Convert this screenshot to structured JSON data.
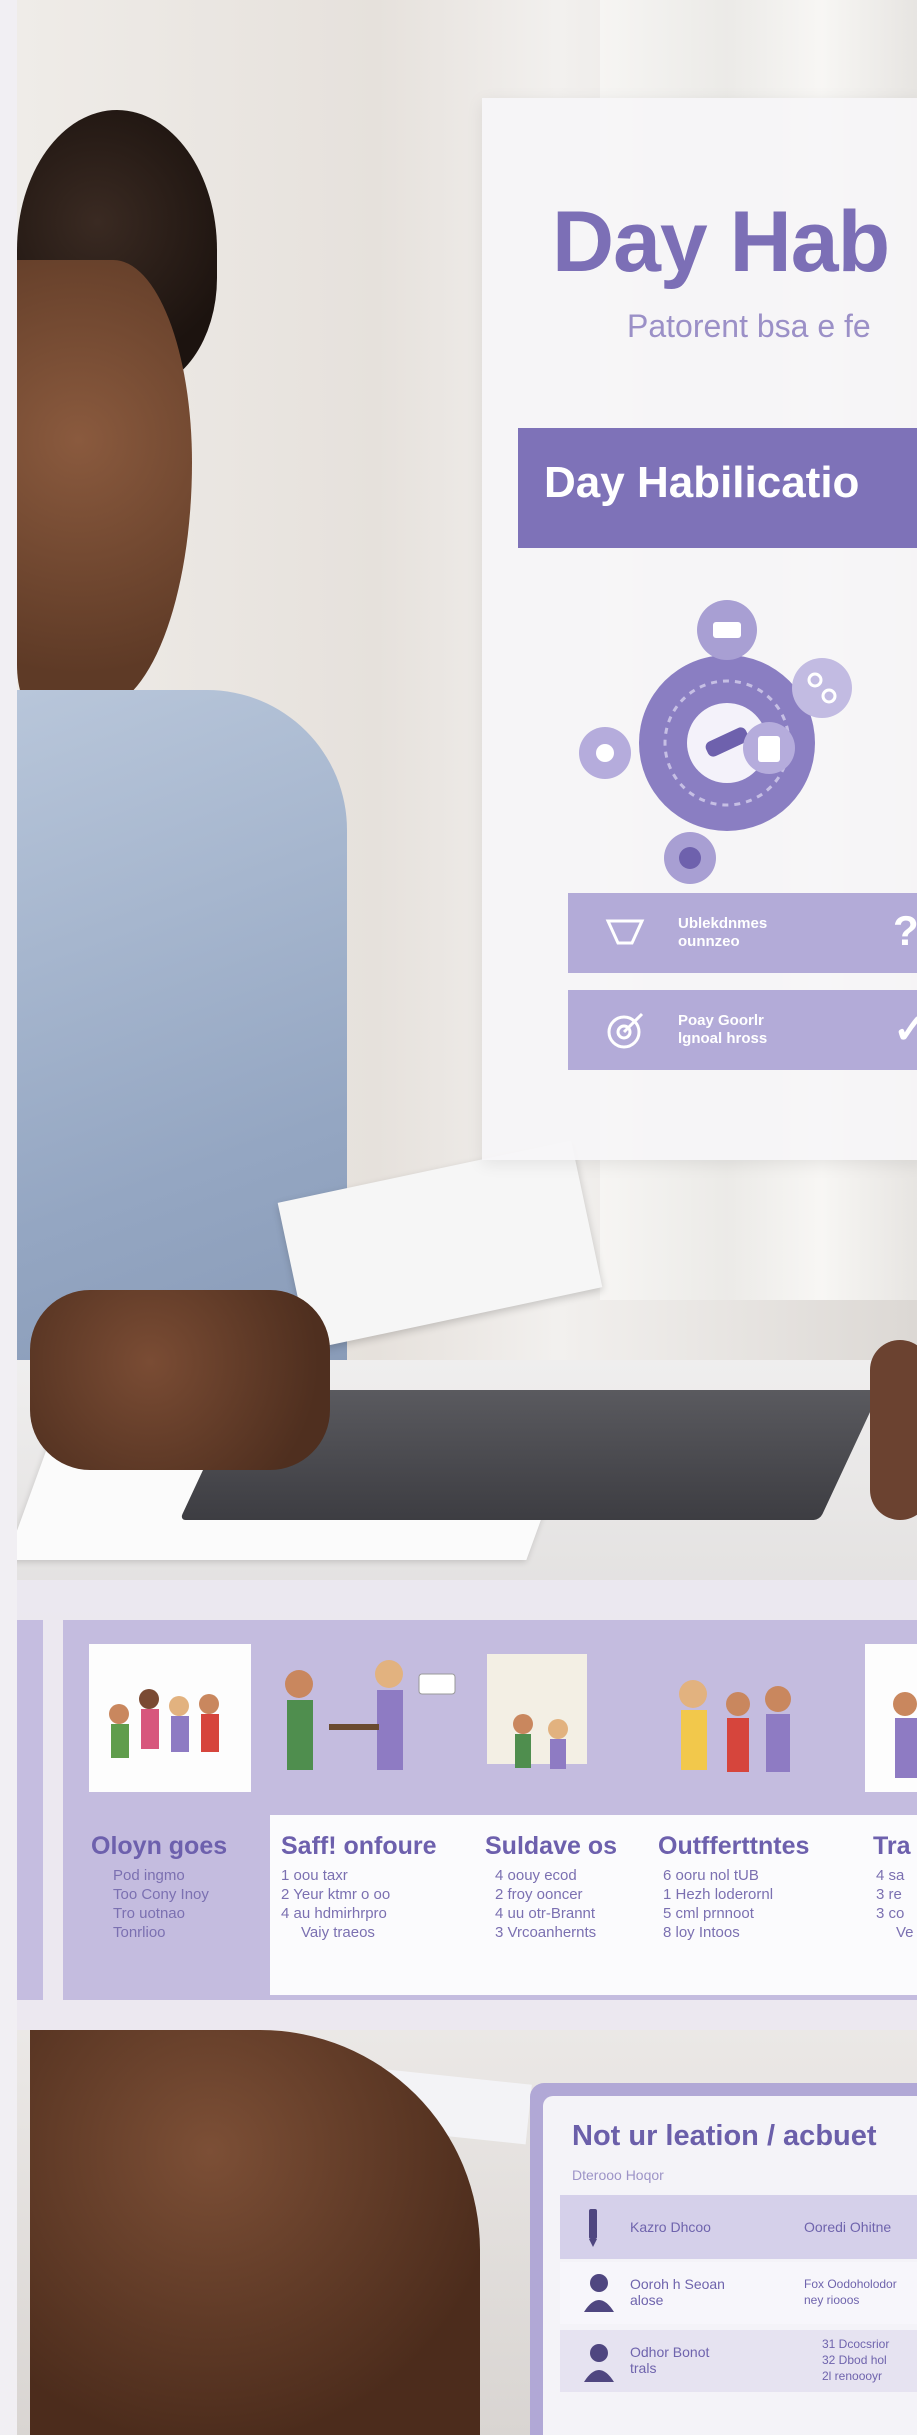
{
  "poster": {
    "title": "Day Hab",
    "subtitle": "Patorent bsa e fe",
    "banner": "Day Habilicatio",
    "status_rows": [
      {
        "label_line1": "Ublekdnmes",
        "label_line2": "ounnzeo",
        "mark": "?"
      },
      {
        "label_line1": "Poay Goorlr",
        "label_line2": "lgnoal hross",
        "mark": "✓"
      }
    ]
  },
  "infographic": {
    "columns": [
      {
        "title": "Oloyn goes",
        "items": [
          "Pod ingmo",
          "Too Cony Inoy",
          "Tro uotnao",
          "Tonrlioo"
        ]
      },
      {
        "title": "Saff! onfoure",
        "items": [
          "1  oou taxr",
          "2  Yeur ktmr o oo",
          "4  au hdmirhrpro",
          "Vaiy traeos"
        ]
      },
      {
        "title": "Suldave os",
        "items": [
          "4  oouy ecod",
          "2  froy ooncer",
          "4  uu otr-Brannt",
          "3  Vrcoanhernts"
        ]
      },
      {
        "title": "Outfferttntes",
        "items": [
          "6  ooru nol tUB",
          "1  Hezh loderornl",
          "5  cml prnnoot",
          "8  loy Intoos"
        ]
      },
      {
        "title": "Tra",
        "items": [
          "4  sa",
          "3  re",
          "3  co",
          "Ve"
        ]
      }
    ]
  },
  "schedule": {
    "title": "Not ur leation / acbuet",
    "subtitle": "Dterooo Hoqor",
    "headers": [
      "Kazro Dhcoo",
      "Ooredi Ohitne"
    ],
    "rows": [
      {
        "name_line1": "Ooroh h Seoan",
        "name_line2": "alose",
        "detail_line1": "Fox Oodoholodor",
        "detail_line2": "ney riooos"
      },
      {
        "name_line1": "Odhor Bonot",
        "name_line2": "trals",
        "detail_line1": "31  Dcocsrior",
        "detail_line2": "32  Dbod hol",
        "detail_line3": "2l  renoooyr"
      }
    ]
  },
  "colors": {
    "accent": "#7e72b8",
    "panel": "#c4bcdf",
    "text": "#6d60ad"
  }
}
